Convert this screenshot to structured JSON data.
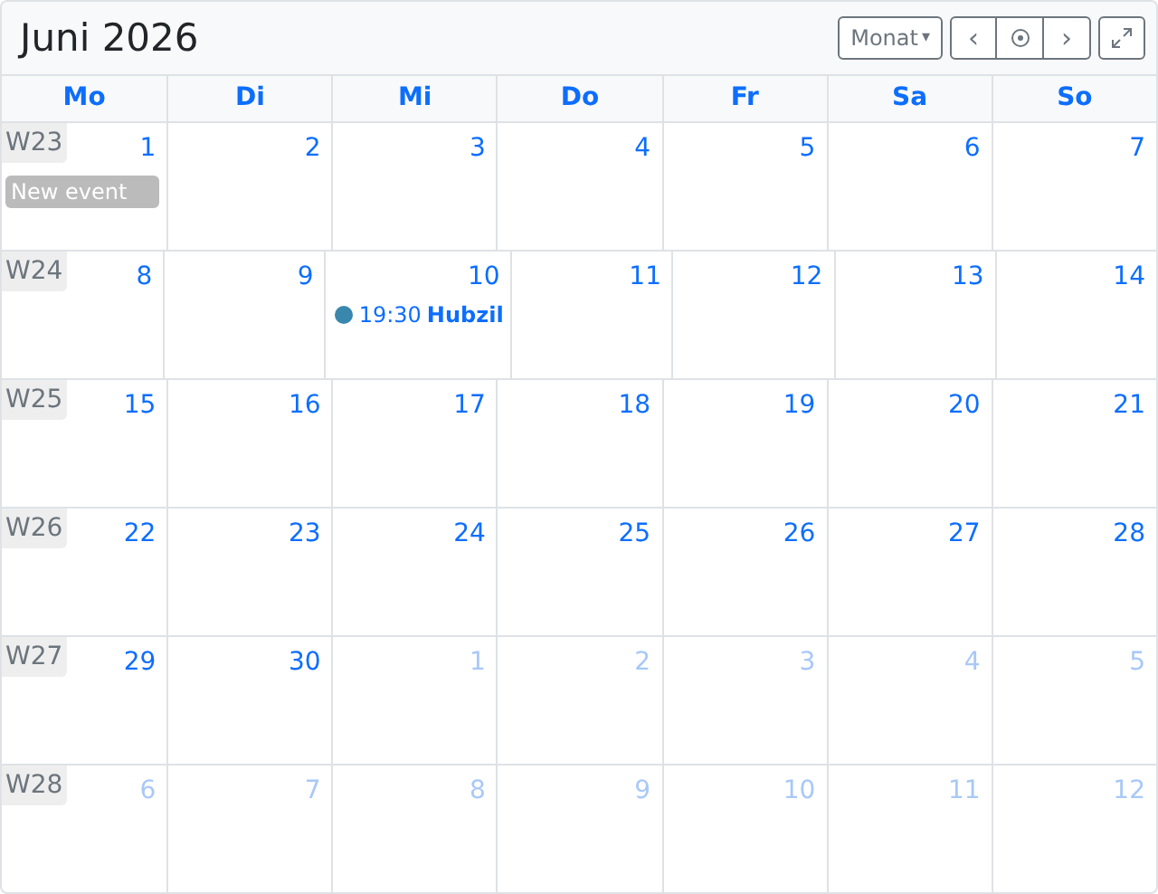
{
  "title": "Juni 2026",
  "toolbar": {
    "view": "Monat",
    "view_caret": "▾",
    "prev": "‹",
    "next": "›"
  },
  "day_headers": [
    "Mo",
    "Di",
    "Mi",
    "Do",
    "Fr",
    "Sa",
    "So"
  ],
  "weeks": [
    {
      "label": "W23",
      "days": [
        {
          "number": "1",
          "other_month": false,
          "events": [
            {
              "kind": "block",
              "title": "New event",
              "color": "#bbbbbb"
            }
          ]
        },
        {
          "number": "2",
          "other_month": false
        },
        {
          "number": "3",
          "other_month": false
        },
        {
          "number": "4",
          "other_month": false
        },
        {
          "number": "5",
          "other_month": false
        },
        {
          "number": "6",
          "other_month": false
        },
        {
          "number": "7",
          "other_month": false
        }
      ]
    },
    {
      "label": "W24",
      "days": [
        {
          "number": "8",
          "other_month": false
        },
        {
          "number": "9",
          "other_month": false
        },
        {
          "number": "10",
          "other_month": false,
          "events": [
            {
              "kind": "dot",
              "time": "19:30",
              "title": "Hubzil",
              "color": "#3a87ad"
            }
          ]
        },
        {
          "number": "11",
          "other_month": false
        },
        {
          "number": "12",
          "other_month": false
        },
        {
          "number": "13",
          "other_month": false
        },
        {
          "number": "14",
          "other_month": false
        }
      ]
    },
    {
      "label": "W25",
      "days": [
        {
          "number": "15",
          "other_month": false
        },
        {
          "number": "16",
          "other_month": false
        },
        {
          "number": "17",
          "other_month": false
        },
        {
          "number": "18",
          "other_month": false
        },
        {
          "number": "19",
          "other_month": false
        },
        {
          "number": "20",
          "other_month": false
        },
        {
          "number": "21",
          "other_month": false
        }
      ]
    },
    {
      "label": "W26",
      "days": [
        {
          "number": "22",
          "other_month": false
        },
        {
          "number": "23",
          "other_month": false
        },
        {
          "number": "24",
          "other_month": false
        },
        {
          "number": "25",
          "other_month": false
        },
        {
          "number": "26",
          "other_month": false
        },
        {
          "number": "27",
          "other_month": false
        },
        {
          "number": "28",
          "other_month": false
        }
      ]
    },
    {
      "label": "W27",
      "days": [
        {
          "number": "29",
          "other_month": false
        },
        {
          "number": "30",
          "other_month": false
        },
        {
          "number": "1",
          "other_month": true
        },
        {
          "number": "2",
          "other_month": true
        },
        {
          "number": "3",
          "other_month": true
        },
        {
          "number": "4",
          "other_month": true
        },
        {
          "number": "5",
          "other_month": true
        }
      ]
    },
    {
      "label": "W28",
      "days": [
        {
          "number": "6",
          "other_month": true
        },
        {
          "number": "7",
          "other_month": true
        },
        {
          "number": "8",
          "other_month": true
        },
        {
          "number": "9",
          "other_month": true
        },
        {
          "number": "10",
          "other_month": true
        },
        {
          "number": "11",
          "other_month": true
        },
        {
          "number": "12",
          "other_month": true
        }
      ]
    }
  ]
}
